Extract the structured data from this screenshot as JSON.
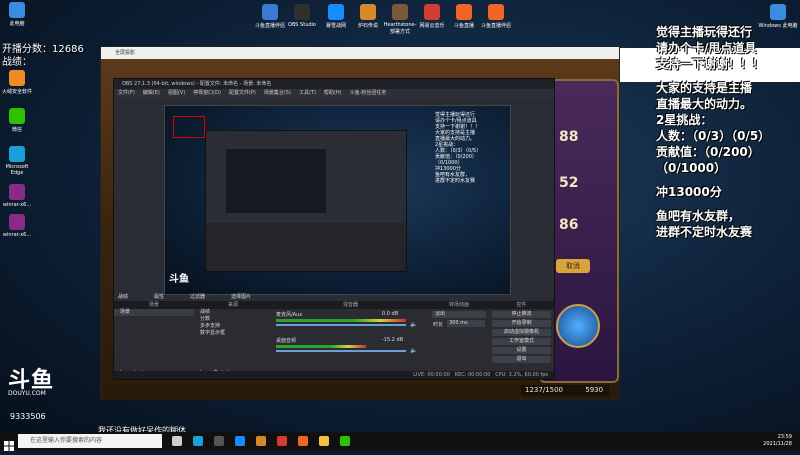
{
  "overlay": {
    "score_line": "开播分数：12686",
    "challenge_label": "战绩：",
    "right_lines": [
      "觉得主播玩得还行",
      "请办个卡/甩点道具",
      "支持一下谢谢！！！",
      "",
      "大家的支持是主播",
      "直播最大的动力。",
      "2星挑战：",
      "人数：（0/3）（0/5）",
      "贡献值：（0/200）",
      "（0/1000）",
      "",
      "冲13000分",
      "",
      "鱼吧有水友群，",
      "进群不定时水友赛"
    ],
    "bottom_caption": "我还没有做好呆作的糊体",
    "douyu_logo": "斗鱼",
    "douyu_url": "DOUYU.COM",
    "room_id": "9333506"
  },
  "desktop_icons": {
    "left": [
      {
        "label": "此电脑",
        "icon": "computer-icon",
        "color": "#3b8be0"
      },
      {
        "label": "火绒安全软件",
        "icon": "huorong-icon",
        "color": "#f08a24"
      },
      {
        "label": "微信",
        "icon": "wechat-icon",
        "color": "#2dc100"
      },
      {
        "label": "Microsoft Edge",
        "icon": "edge-icon",
        "color": "#1aa0d8"
      },
      {
        "label": "winrar-x6...",
        "icon": "winrar-icon",
        "color": "#8a2b8a"
      },
      {
        "label": "winrar-x6...",
        "icon": "winrar-icon",
        "color": "#8a2b8a"
      }
    ],
    "top": [
      {
        "label": "斗鱼直播伴侣",
        "icon": "douyu-companion-icon",
        "color": "#3a7bd5"
      },
      {
        "label": "OBS Studio",
        "icon": "obs-icon",
        "color": "#303030"
      },
      {
        "label": "暴雪战网",
        "icon": "battlenet-icon",
        "color": "#148eff"
      },
      {
        "label": "炉石传说",
        "icon": "hearthstone-icon",
        "color": "#d58a2a"
      },
      {
        "label": "Hearthstone-部署方式",
        "icon": "hearthstone-deck-icon",
        "color": "#7a5a3a"
      },
      {
        "label": "网易云音乐",
        "icon": "netease-music-icon",
        "color": "#d43c33"
      },
      {
        "label": "斗鱼直播",
        "icon": "douyu-live-icon",
        "color": "#f26522"
      },
      {
        "label": "斗鱼直播伴侣",
        "icon": "douyu-companion-icon",
        "color": "#f26522"
      }
    ],
    "right": [
      {
        "label": "Windows 此电脑",
        "icon": "windows-computer-icon",
        "color": "#3b8be0"
      }
    ]
  },
  "projector": {
    "title": "全屏投影",
    "game_score": "5930",
    "game_fraction": "1237/1500",
    "game_numbers": [
      "88",
      "52",
      "86"
    ],
    "game_button": "取消"
  },
  "obs": {
    "title": "OBS 27.1.3 (64-bit, windows) - 配置文件: 未命名 - 场景: 未命名",
    "menu": [
      "文件(F)",
      "编辑(E)",
      "视图(V)",
      "停靠窗口(D)",
      "配置文件(P)",
      "场景集合(S)",
      "工具(T)",
      "帮助(H)",
      "斗鱼-粉丝团任务"
    ],
    "docks": {
      "scenes": {
        "title": "场景",
        "items": [
          "场景"
        ]
      },
      "sources": {
        "title": "来源",
        "items": [
          "战绩",
          "分数",
          "多步支持",
          "数字显示框"
        ]
      },
      "mixer": {
        "title": "混音器",
        "channels": [
          {
            "name": "桌面音频",
            "db": "-15.2 dB"
          },
          {
            "name": "麦克风/Aux",
            "db": "0.0 dB"
          }
        ]
      },
      "transitions": {
        "title": "转场动画",
        "type": "淡出",
        "duration_label": "时长",
        "duration": "300 ms"
      },
      "controls": {
        "title": "控件",
        "buttons": [
          "停止推流",
          "开始录制",
          "启动虚拟摄像机",
          "工作室模式",
          "设置",
          "退出"
        ]
      }
    },
    "tabs": [
      "战绩",
      "属性",
      "过滤器",
      "选择图片"
    ],
    "status": {
      "live": "LIVE: 00:00:00",
      "rec": "REC: 00:00:00",
      "cpu": "CPU: 3.2%, 60.00 fps"
    }
  },
  "taskbar": {
    "search_placeholder": "在这里输入你要搜索的内容",
    "time": "23:59",
    "date": "2021/11/28",
    "apps": [
      {
        "icon": "task-view-icon",
        "color": "#cfcfcf"
      },
      {
        "icon": "edge-icon",
        "color": "#1aa0d8"
      },
      {
        "icon": "obs-icon",
        "color": "#555555"
      },
      {
        "icon": "battlenet-icon",
        "color": "#148eff"
      },
      {
        "icon": "hearthstone-icon",
        "color": "#d58a2a"
      },
      {
        "icon": "netease-music-icon",
        "color": "#d43c33"
      },
      {
        "icon": "douyu-icon",
        "color": "#f26522"
      },
      {
        "icon": "file-explorer-icon",
        "color": "#f5c242"
      },
      {
        "icon": "wechat-icon",
        "color": "#2dc100"
      }
    ]
  }
}
